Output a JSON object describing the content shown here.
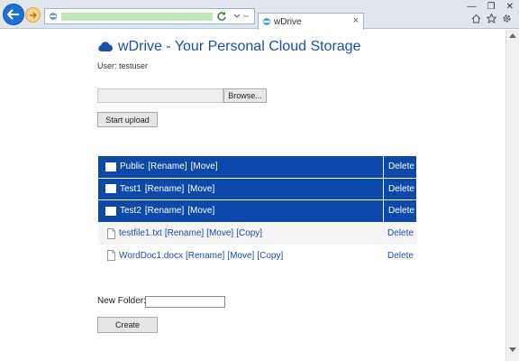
{
  "browser": {
    "tab_title": "wDrive",
    "tab_close": "×",
    "window_controls": [
      "—",
      "❐",
      "✕"
    ]
  },
  "page": {
    "title": "wDrive - Your Personal Cloud Storage",
    "user_line": "User: testuser"
  },
  "upload": {
    "browse_label": "Browse...",
    "start_label": "Start upload"
  },
  "items": [
    {
      "type": "folder",
      "name": "Public",
      "actions": [
        "[Rename]",
        "[Move]"
      ],
      "delete": "Delete"
    },
    {
      "type": "folder",
      "name": "Test1",
      "actions": [
        "[Rename]",
        "[Move]"
      ],
      "delete": "Delete"
    },
    {
      "type": "folder",
      "name": "Test2",
      "actions": [
        "[Rename]",
        "[Move]"
      ],
      "delete": "Delete"
    },
    {
      "type": "file",
      "name": "testfile1.txt",
      "actions": [
        "[Rename]",
        "[Move]",
        "[Copy]"
      ],
      "delete": "Delete"
    },
    {
      "type": "file",
      "name": "WordDoc1.docx",
      "actions": [
        "[Rename]",
        "[Move]",
        "[Copy]"
      ],
      "delete": "Delete"
    }
  ],
  "new_folder": {
    "label": "New Folder:",
    "value": "",
    "create_label": "Create"
  },
  "colors": {
    "accent": "#0c49aa",
    "link": "#1a4fae"
  }
}
